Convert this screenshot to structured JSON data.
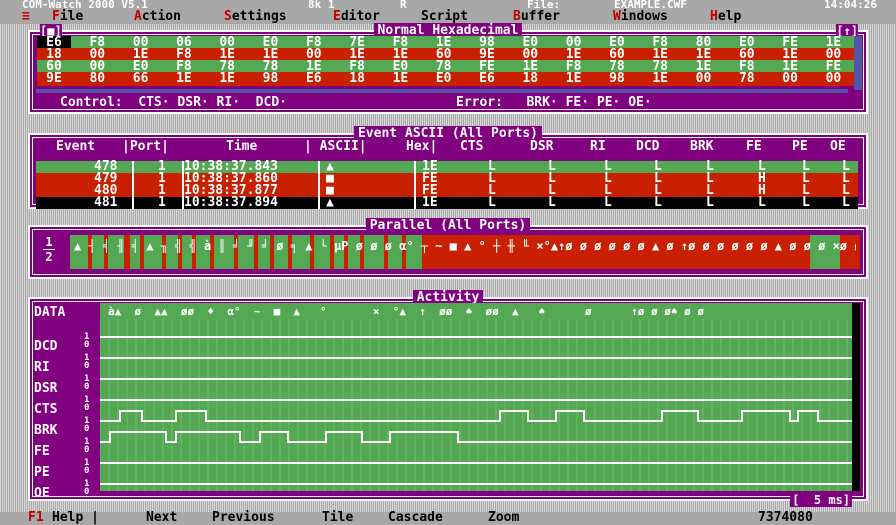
{
  "titlebar": {
    "app": "COM-Watch 2000 V5.1",
    "mem": "8k 1",
    "mode": "R",
    "file_label": "File:",
    "file_name": "EXAMPLE.CWF",
    "clock": "14:04:26"
  },
  "menu": {
    "system": "≡",
    "items": [
      {
        "hot": "F",
        "rest": "ile"
      },
      {
        "hot": "A",
        "rest": "ction"
      },
      {
        "hot": "S",
        "rest": "ettings"
      },
      {
        "hot": "E",
        "rest": "ditor"
      },
      {
        "hot": "",
        "rest": "Script"
      },
      {
        "hot": "B",
        "rest": "uffer"
      },
      {
        "hot": "W",
        "rest": "indows"
      },
      {
        "hot": "H",
        "rest": "elp"
      }
    ]
  },
  "hex_panel": {
    "title": "Normal Hexadecimal",
    "close_glyph": "[■]",
    "zoom_glyph": "[↑]",
    "rows": [
      [
        "E6",
        "F8",
        "00",
        "06",
        "00",
        "E0",
        "F8",
        "7E",
        "F8",
        "1E",
        "98",
        "E0",
        "00",
        "E0",
        "F8",
        "80",
        "E0",
        "FE",
        "1E"
      ],
      [
        "18",
        "00",
        "1E",
        "F8",
        "1E",
        "1E",
        "00",
        "1E",
        "1E",
        "60",
        "9E",
        "00",
        "1E",
        "60",
        "1E",
        "1E",
        "60",
        "1E",
        "00"
      ],
      [
        "60",
        "00",
        "E0",
        "F8",
        "78",
        "78",
        "1E",
        "F8",
        "E0",
        "78",
        "FE",
        "1E",
        "F8",
        "78",
        "78",
        "1E",
        "F8",
        "1E",
        "FE"
      ],
      [
        "9E",
        "80",
        "66",
        "1E",
        "1E",
        "98",
        "E6",
        "18",
        "1E",
        "E0",
        "E6",
        "18",
        "1E",
        "98",
        "1E",
        "00",
        "78",
        "00",
        "00"
      ]
    ],
    "control_label": "Control:",
    "control_signals": "CTS· DSR· RI·  DCD·",
    "error_label": "Error:",
    "error_signals": "BRK· FE· PE· OE·"
  },
  "event_panel": {
    "title": "Event ASCII (All Ports)",
    "headers": [
      "Event",
      "|Port|",
      "Time",
      "| ASCII|",
      "Hex|",
      "CTS",
      "DSR",
      "RI",
      "DCD",
      "BRK",
      "FE",
      "PE",
      "OE"
    ],
    "rows": [
      {
        "event": "478",
        "port": "1",
        "time": "10:38:37.843",
        "ascii": "▲",
        "hex": "1E",
        "cts": "L",
        "dsr": "L",
        "ri": "L",
        "dcd": "L",
        "brk": "L",
        "fe": "L",
        "pe": "L",
        "oe": "L"
      },
      {
        "event": "479",
        "port": "1",
        "time": "10:38:37.860",
        "ascii": "■",
        "hex": "FE",
        "cts": "L",
        "dsr": "L",
        "ri": "L",
        "dcd": "L",
        "brk": "L",
        "fe": "H",
        "pe": "L",
        "oe": "L"
      },
      {
        "event": "480",
        "port": "1",
        "time": "10:38:37.877",
        "ascii": "■",
        "hex": "FE",
        "cts": "L",
        "dsr": "L",
        "ri": "L",
        "dcd": "L",
        "brk": "L",
        "fe": "H",
        "pe": "L",
        "oe": "L"
      },
      {
        "event": "481",
        "port": "1",
        "time": "10:38:37.894",
        "ascii": "▲",
        "hex": "1E",
        "cts": "L",
        "dsr": "L",
        "ri": "L",
        "dcd": "L",
        "brk": "L",
        "fe": "L",
        "pe": "L",
        "oe": "L"
      }
    ]
  },
  "parallel_panel": {
    "title": "Parallel (All Ports)",
    "port_top": "1",
    "port_bottom": "2",
    "stream": "▲ ┤ ╡ ╢ ╡ ▲ ╖ ╣ ╣ à ║ ╛ ╜ ╛ ø ╕ ▲ └ µP ø ø ø α° ┬ ~ ■ ▲ ° ┼ ╫ ╙ ×°▲↑ø ø ø ø ø ø ▲ ø ↑ø ø ø ø ø ø ▲ ø ø ø ×ø ø ° ø ø ▲ø ø ■ ▲ ▲"
  },
  "activity_panel": {
    "title": "Activity",
    "data_label": "DATA",
    "data_stream": "à▲  ø  ▲▲  øø  ♦  α°  ~  ■  ▲   °       ×  °▲  ↑  øø  ♠  øø  ▲   ♠      ø      ↑ø ø ø♠ ø ø",
    "signals": [
      "DCD",
      "RI",
      "DSR",
      "CTS",
      "BRK",
      "FE",
      "PE",
      "OE"
    ],
    "level_high": "1",
    "level_low": "0",
    "scale": "[  5 ms]"
  },
  "statusbar": {
    "f1_key": "F1",
    "f1_label": "Help |",
    "items": [
      "Next",
      "Previous",
      "Tile",
      "Cascade",
      "Zoom"
    ],
    "counter": "7374080"
  },
  "colors": {
    "panel": "#800080",
    "green": "#54a854",
    "red": "#c82000",
    "white": "#ffffff",
    "black": "#000000"
  }
}
